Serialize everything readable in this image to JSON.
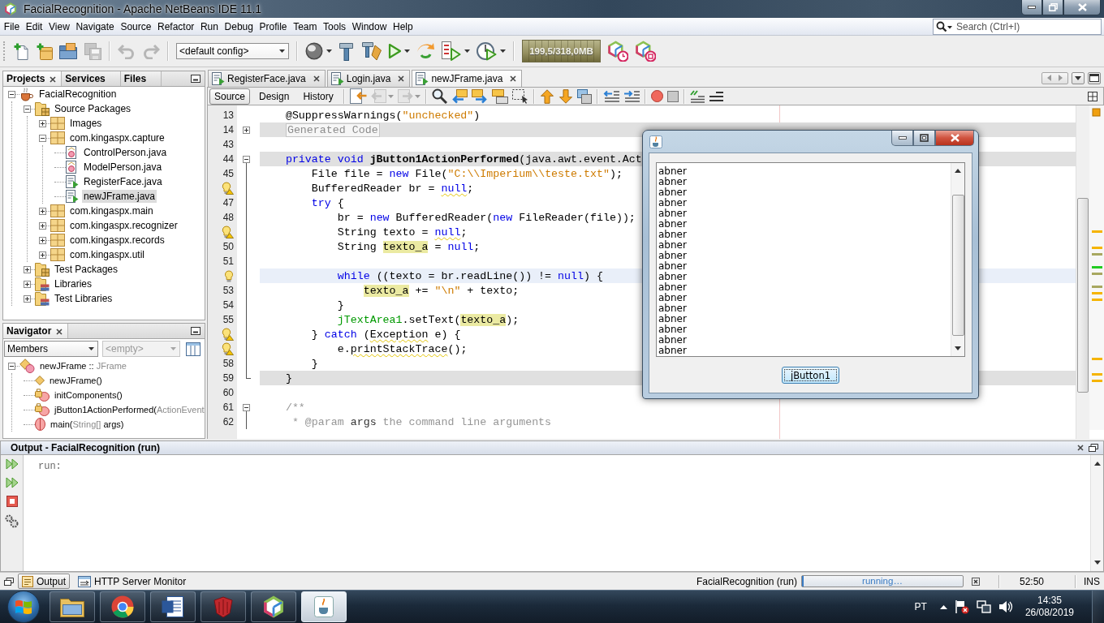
{
  "window": {
    "title": "FacialRecognition - Apache NetBeans IDE 11.1"
  },
  "menu": [
    "File",
    "Edit",
    "View",
    "Navigate",
    "Source",
    "Refactor",
    "Run",
    "Debug",
    "Profile",
    "Team",
    "Tools",
    "Window",
    "Help"
  ],
  "search": {
    "placeholder": "Search (Ctrl+I)"
  },
  "toolbar": {
    "file_buttons": [
      {
        "kind": "new_file",
        "disabled": false
      },
      {
        "kind": "new_project",
        "disabled": false
      },
      {
        "kind": "open_project",
        "disabled": false
      },
      {
        "kind": "save_all",
        "disabled": true
      }
    ],
    "edit_buttons": [
      {
        "kind": "undo",
        "disabled": true
      },
      {
        "kind": "redo",
        "disabled": true
      }
    ],
    "config": "<default config>",
    "run_buttons": [
      {
        "kind": "globe",
        "disabled": false
      },
      {
        "kind": "build",
        "disabled": false
      },
      {
        "kind": "clean_build",
        "disabled": false
      },
      {
        "kind": "run",
        "disabled": false
      },
      {
        "kind": "debug",
        "disabled": false
      },
      {
        "kind": "test",
        "disabled": false
      },
      {
        "kind": "profile",
        "disabled": false
      }
    ],
    "memory": "199,5/318,0MB",
    "profiler_buttons": [
      {
        "kind": "profile_cube",
        "disabled": false
      },
      {
        "kind": "stop_cube",
        "disabled": false
      }
    ]
  },
  "projects": {
    "tabs": [
      {
        "label": "Projects",
        "selected": true
      },
      {
        "label": "Services",
        "selected": false
      },
      {
        "label": "Files",
        "selected": false
      }
    ],
    "tree": [
      {
        "label": "FacialRecognition",
        "kind": "project",
        "expanded": true,
        "selected": false,
        "children": [
          {
            "label": "Source Packages",
            "kind": "source_root",
            "expanded": true,
            "selected": false,
            "children": [
              {
                "label": "Images",
                "kind": "package",
                "expanded": false,
                "selected": false
              },
              {
                "label": "com.kingaspx.capture",
                "kind": "package",
                "expanded": true,
                "selected": false,
                "children": [
                  {
                    "label": "ControlPerson.java",
                    "kind": "class",
                    "selected": false
                  },
                  {
                    "label": "ModelPerson.java",
                    "kind": "class",
                    "selected": false
                  },
                  {
                    "label": "RegisterFace.java",
                    "kind": "form",
                    "selected": false
                  },
                  {
                    "label": "newJFrame.java",
                    "kind": "form",
                    "selected": true
                  }
                ]
              },
              {
                "label": "com.kingaspx.main",
                "kind": "package",
                "expanded": false,
                "selected": false
              },
              {
                "label": "com.kingaspx.recognizer",
                "kind": "package",
                "expanded": false,
                "selected": false
              },
              {
                "label": "com.kingaspx.records",
                "kind": "package",
                "expanded": false,
                "selected": false
              },
              {
                "label": "com.kingaspx.util",
                "kind": "package",
                "expanded": false,
                "selected": false
              }
            ]
          },
          {
            "label": "Test Packages",
            "kind": "test_root",
            "expanded": false,
            "selected": false
          },
          {
            "label": "Libraries",
            "kind": "library",
            "expanded": false,
            "selected": false
          },
          {
            "label": "Test Libraries",
            "kind": "library",
            "expanded": false,
            "selected": false
          }
        ]
      }
    ]
  },
  "navigator": {
    "title": "Navigator",
    "filter": "Members",
    "scope": {
      "value": "<empty>",
      "disabled": true
    },
    "tree": [
      {
        "parts": [
          {
            "text": "newJFrame :: ",
            "dim": false
          },
          {
            "text": "JFrame",
            "dim": true
          }
        ],
        "kind": "class",
        "expanded": true,
        "selected": false,
        "children": [
          {
            "parts": [
              {
                "text": "newJFrame()",
                "dim": false
              }
            ],
            "kind": "constructor",
            "selected": false
          },
          {
            "parts": [
              {
                "text": "initComponents()",
                "dim": false
              }
            ],
            "kind": "private_method",
            "selected": false
          },
          {
            "parts": [
              {
                "text": "jButton1ActionPerformed(",
                "dim": false
              },
              {
                "text": "ActionEvent",
                "dim": true
              }
            ],
            "kind": "private_method",
            "selected": false
          },
          {
            "parts": [
              {
                "text": "main(",
                "dim": false
              },
              {
                "text": "String[]",
                "dim": true
              },
              {
                "text": " args)",
                "dim": false
              }
            ],
            "kind": "static_method",
            "selected": false
          }
        ]
      }
    ]
  },
  "editor": {
    "tabs": [
      {
        "label": "RegisterFace.java",
        "selected": false
      },
      {
        "label": "Login.java",
        "selected": false
      },
      {
        "label": "newJFrame.java",
        "selected": true
      }
    ],
    "views": [
      {
        "label": "Source",
        "selected": true
      },
      {
        "label": "Design",
        "selected": false
      },
      {
        "label": "History",
        "selected": false
      }
    ],
    "toolbar": [
      [
        {
          "kind": "last_edit",
          "disabled": false
        },
        {
          "kind": "back",
          "disabled": true
        },
        {
          "kind": "forward",
          "disabled": true
        }
      ],
      [
        {
          "kind": "find",
          "disabled": false
        },
        {
          "kind": "find_previous",
          "disabled": false
        },
        {
          "kind": "find_next",
          "disabled": false
        },
        {
          "kind": "highlight",
          "disabled": false
        },
        {
          "kind": "rect_select",
          "disabled": false
        }
      ],
      [
        {
          "kind": "prev_bookmark",
          "disabled": false
        },
        {
          "kind": "next_bookmark",
          "disabled": false
        },
        {
          "kind": "toggle_bookmark",
          "disabled": false
        }
      ],
      [
        {
          "kind": "shift_left",
          "disabled": false
        },
        {
          "kind": "shift_right",
          "disabled": false
        }
      ],
      [
        {
          "kind": "record",
          "disabled": false
        },
        {
          "kind": "stop_macro",
          "disabled": false
        }
      ],
      [
        {
          "kind": "comment",
          "disabled": false
        },
        {
          "kind": "uncomment",
          "disabled": false
        }
      ]
    ],
    "lines": [
      {
        "kind": "number",
        "number": "13",
        "guarded": false,
        "current": false,
        "tokens": [
          {
            "text": "@SuppressWarnings(",
            "kind": "plain"
          },
          {
            "text": "\"unchecked\"",
            "kind": "string"
          },
          {
            "text": ")",
            "kind": "plain"
          }
        ]
      },
      {
        "kind": "number",
        "number": "14",
        "guarded": true,
        "current": false,
        "expanded": false,
        "tokens": [
          {
            "text": "Generated Code",
            "kind": "fold"
          }
        ]
      },
      {
        "kind": "number",
        "number": "43",
        "guarded": false,
        "current": false
      },
      {
        "kind": "number",
        "number": "44",
        "guarded": true,
        "current": false,
        "expanded": true,
        "tokens": [
          {
            "text": "private void ",
            "kind": "keyword"
          },
          {
            "text": "jButton1ActionPerformed",
            "kind": "declaration"
          },
          {
            "text": "(java.awt.event.Act",
            "kind": "plain"
          }
        ],
        "children": [
          {
            "kind": "number",
            "number": "45",
            "guarded": false,
            "current": false,
            "tokens": [
              {
                "text": "File file = ",
                "kind": "plain"
              },
              {
                "text": "new",
                "kind": "keyword"
              },
              {
                "text": " File(",
                "kind": "plain"
              },
              {
                "text": "\"C:\\\\Imperium\\\\teste.txt\"",
                "kind": "string"
              },
              {
                "text": ");",
                "kind": "plain"
              }
            ]
          },
          {
            "kind": "warning",
            "guarded": false,
            "current": false,
            "tokens": [
              {
                "text": "BufferedReader br = ",
                "kind": "plain"
              },
              {
                "text": "null",
                "kind": "keyword_warn"
              },
              {
                "text": ";",
                "kind": "plain"
              }
            ]
          },
          {
            "kind": "number",
            "number": "47",
            "guarded": false,
            "current": false,
            "tokens": [
              {
                "text": "try",
                "kind": "keyword"
              },
              {
                "text": " {",
                "kind": "plain"
              }
            ],
            "children": [
              {
                "kind": "number",
                "number": "48",
                "guarded": false,
                "current": false,
                "tokens": [
                  {
                    "text": "br = ",
                    "kind": "plain"
                  },
                  {
                    "text": "new",
                    "kind": "keyword"
                  },
                  {
                    "text": " BufferedReader(",
                    "kind": "plain"
                  },
                  {
                    "text": "new",
                    "kind": "keyword"
                  },
                  {
                    "text": " FileReader(file));",
                    "kind": "plain"
                  }
                ]
              },
              {
                "kind": "warning",
                "guarded": false,
                "current": false,
                "tokens": [
                  {
                    "text": "String texto = ",
                    "kind": "plain"
                  },
                  {
                    "text": "null",
                    "kind": "keyword_warn"
                  },
                  {
                    "text": ";",
                    "kind": "plain"
                  }
                ]
              },
              {
                "kind": "number",
                "number": "50",
                "guarded": false,
                "current": false,
                "tokens": [
                  {
                    "text": "String ",
                    "kind": "plain"
                  },
                  {
                    "text": "texto_a",
                    "kind": "occurrence"
                  },
                  {
                    "text": " = ",
                    "kind": "plain"
                  },
                  {
                    "text": "null",
                    "kind": "keyword"
                  },
                  {
                    "text": ";",
                    "kind": "plain"
                  }
                ]
              },
              {
                "kind": "number",
                "number": "51",
                "guarded": false,
                "current": false
              },
              {
                "kind": "hint",
                "guarded": false,
                "current": true,
                "tokens": [
                  {
                    "text": "while",
                    "kind": "keyword"
                  },
                  {
                    "text": " ((texto = br.readLine()) != ",
                    "kind": "plain"
                  },
                  {
                    "text": "null",
                    "kind": "keyword"
                  },
                  {
                    "text": ") {",
                    "kind": "plain"
                  }
                ],
                "children": [
                  {
                    "kind": "number",
                    "number": "53",
                    "guarded": false,
                    "current": false,
                    "tokens": [
                      {
                        "text": "texto_a",
                        "kind": "occurrence"
                      },
                      {
                        "text": " += ",
                        "kind": "plain"
                      },
                      {
                        "text": "\"\\n\"",
                        "kind": "string"
                      },
                      {
                        "text": " + texto;",
                        "kind": "plain"
                      }
                    ]
                  }
                ]
              },
              {
                "kind": "number",
                "number": "54",
                "guarded": false,
                "current": false,
                "tokens": [
                  {
                    "text": "}",
                    "kind": "plain"
                  }
                ]
              },
              {
                "kind": "number",
                "number": "55",
                "guarded": false,
                "current": false,
                "tokens": [
                  {
                    "text": "jTextArea1",
                    "kind": "field"
                  },
                  {
                    "text": ".setText(",
                    "kind": "plain"
                  },
                  {
                    "text": "texto_a",
                    "kind": "occurrence"
                  },
                  {
                    "text": ");",
                    "kind": "plain"
                  }
                ]
              }
            ]
          },
          {
            "kind": "warning",
            "guarded": false,
            "current": false,
            "tokens": [
              {
                "text": "} ",
                "kind": "plain"
              },
              {
                "text": "catch",
                "kind": "keyword"
              },
              {
                "text": " (",
                "kind": "plain"
              },
              {
                "text": "Exception",
                "kind": "plain_warn"
              },
              {
                "text": " e) {",
                "kind": "plain"
              }
            ],
            "children": [
              {
                "kind": "warning",
                "guarded": false,
                "current": false,
                "tokens": [
                  {
                    "text": "e.",
                    "kind": "plain"
                  },
                  {
                    "text": "printStackTrace",
                    "kind": "plain_warn"
                  },
                  {
                    "text": "();",
                    "kind": "plain"
                  }
                ]
              }
            ]
          },
          {
            "kind": "number",
            "number": "58",
            "guarded": false,
            "current": false,
            "tokens": [
              {
                "text": "}",
                "kind": "plain"
              }
            ]
          }
        ]
      },
      {
        "kind": "number",
        "number": "59",
        "guarded": true,
        "current": false,
        "fold_end": true,
        "tokens": [
          {
            "text": "}",
            "kind": "plain"
          }
        ]
      },
      {
        "kind": "number",
        "number": "60",
        "guarded": false,
        "current": false
      },
      {
        "kind": "number",
        "number": "61",
        "guarded": false,
        "current": false,
        "expanded": true,
        "tokens": [
          {
            "text": "/**",
            "kind": "comment"
          }
        ]
      },
      {
        "kind": "number",
        "number": "62",
        "guarded": false,
        "current": false,
        "tokens": [
          {
            "text": "* @param ",
            "kind": "doc_comment"
          },
          {
            "text": "args",
            "kind": "comment_name"
          },
          {
            "text": " the command line arguments",
            "kind": "comment"
          }
        ]
      }
    ]
  },
  "dialog": {
    "lines": [
      "abner",
      "abner",
      "abner",
      "abner",
      "abner",
      "abner",
      "abner",
      "abner",
      "abner",
      "abner",
      "abner",
      "abner",
      "abner",
      "abner",
      "abner",
      "abner",
      "abner",
      "abner"
    ],
    "button": "jButton1"
  },
  "output": {
    "title": "Output - FacialRecognition (run)",
    "text": "run:"
  },
  "status": {
    "tabs": [
      {
        "label": "Output",
        "selected": true
      },
      {
        "label": "HTTP Server Monitor",
        "selected": false
      }
    ],
    "task": "FacialRecognition (run)",
    "progress": {
      "text": "running…",
      "level": 0.01
    },
    "position": "52:50",
    "mode": "INS"
  },
  "taskbar": {
    "apps": [
      {
        "kind": "explorer",
        "selected": false
      },
      {
        "kind": "chrome",
        "selected": false
      },
      {
        "kind": "word",
        "selected": false
      },
      {
        "kind": "red_app",
        "selected": false
      },
      {
        "kind": "netbeans",
        "selected": false
      },
      {
        "kind": "java",
        "selected": true
      }
    ],
    "language": "PT",
    "time": "14:35",
    "date": "26/08/2019"
  }
}
